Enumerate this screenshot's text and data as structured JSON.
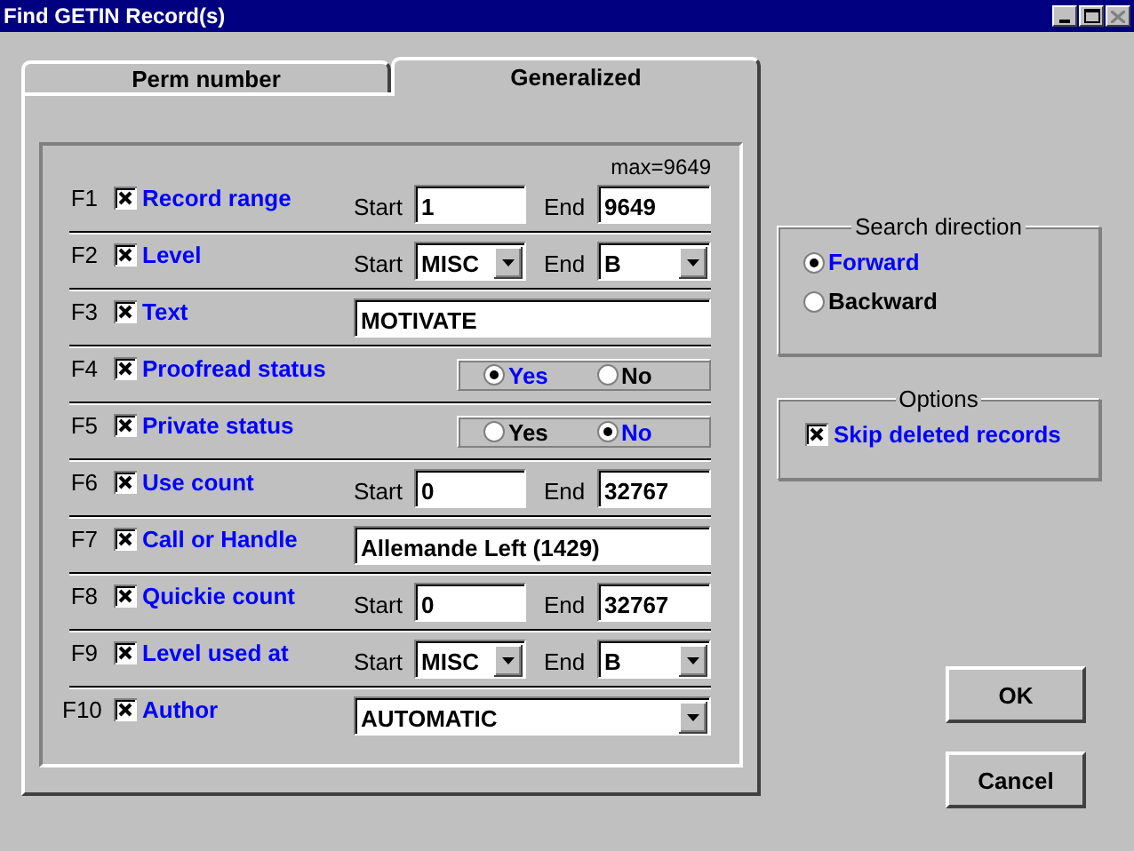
{
  "window": {
    "title": "Find GETIN Record(s)",
    "controls": [
      {
        "kind": "minimize",
        "disabled": false
      },
      {
        "kind": "maximize",
        "disabled": false
      },
      {
        "kind": "close",
        "disabled": true
      }
    ]
  },
  "tabs": [
    {
      "label": "Perm number",
      "selected": false
    },
    {
      "label": "Generalized",
      "selected": true
    }
  ],
  "note": "max=9649",
  "rows": [
    {
      "key": "F1",
      "checked": true,
      "label": "Record range",
      "kind": "range",
      "start_label": "Start",
      "start": "1",
      "end_label": "End",
      "end": "9649"
    },
    {
      "key": "F2",
      "checked": true,
      "label": "Level",
      "kind": "combo_range",
      "start_label": "Start",
      "start": "MISC",
      "end_label": "End",
      "end": "B"
    },
    {
      "key": "F3",
      "checked": true,
      "label": "Text",
      "kind": "text",
      "value": "MOTIVATE"
    },
    {
      "key": "F4",
      "checked": true,
      "label": "Proofread status",
      "kind": "radio",
      "options": [
        {
          "label": "Yes",
          "selected": true
        },
        {
          "label": "No",
          "selected": false
        }
      ]
    },
    {
      "key": "F5",
      "checked": true,
      "label": "Private status",
      "kind": "radio",
      "options": [
        {
          "label": "Yes",
          "selected": false
        },
        {
          "label": "No",
          "selected": true
        }
      ]
    },
    {
      "key": "F6",
      "checked": true,
      "label": "Use count",
      "kind": "range",
      "start_label": "Start",
      "start": "0",
      "end_label": "End",
      "end": "32767"
    },
    {
      "key": "F7",
      "checked": true,
      "label": "Call or Handle",
      "kind": "text",
      "value": "Allemande Left (1429)"
    },
    {
      "key": "F8",
      "checked": true,
      "label": "Quickie count",
      "kind": "range",
      "start_label": "Start",
      "start": "0",
      "end_label": "End",
      "end": "32767"
    },
    {
      "key": "F9",
      "checked": true,
      "label": "Level used at",
      "kind": "combo_range",
      "start_label": "Start",
      "start": "MISC",
      "end_label": "End",
      "end": "B"
    },
    {
      "key": "F10",
      "checked": true,
      "label": "Author",
      "kind": "combo",
      "value": "AUTOMATIC"
    }
  ],
  "search_direction": {
    "title": "Search direction",
    "options": [
      {
        "label": "Forward",
        "selected": true
      },
      {
        "label": "Backward",
        "selected": false
      }
    ]
  },
  "options": {
    "title": "Options",
    "items": [
      {
        "label": "Skip deleted records",
        "checked": true
      }
    ]
  },
  "buttons": [
    {
      "label": "OK"
    },
    {
      "label": "Cancel"
    }
  ]
}
